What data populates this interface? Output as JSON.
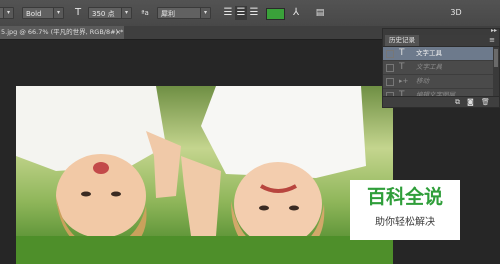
{
  "options_bar": {
    "font_style_partial": "",
    "font_weight": "Bold",
    "font_size": "350 点",
    "aa_label": "ªa",
    "aa_mode": "犀利",
    "color_swatch": "#3aa13a"
  },
  "document_tab": {
    "title": "5.jpg @ 66.7% (平凡的世界, RGB/8#) *",
    "close": "×"
  },
  "history_panel": {
    "tab_label": "历史记录",
    "menu": "≡",
    "collapse": "▸▸",
    "close": "×",
    "items": [
      {
        "icon": "T",
        "label": "文字工具",
        "active": true
      },
      {
        "icon": "T",
        "label": "文字工具",
        "active": false
      },
      {
        "icon": "▸+",
        "label": "移动",
        "active": false
      },
      {
        "icon": "T",
        "label": "编辑文字图层",
        "active": false
      }
    ],
    "footer_icons": [
      "new-snapshot",
      "camera",
      "trash"
    ]
  },
  "watermark": {
    "line1": "百科全说",
    "line2": "助你轻松解决",
    "accent": "#2f9e3a"
  },
  "toolbar_right": {
    "label_3d": "3D"
  }
}
